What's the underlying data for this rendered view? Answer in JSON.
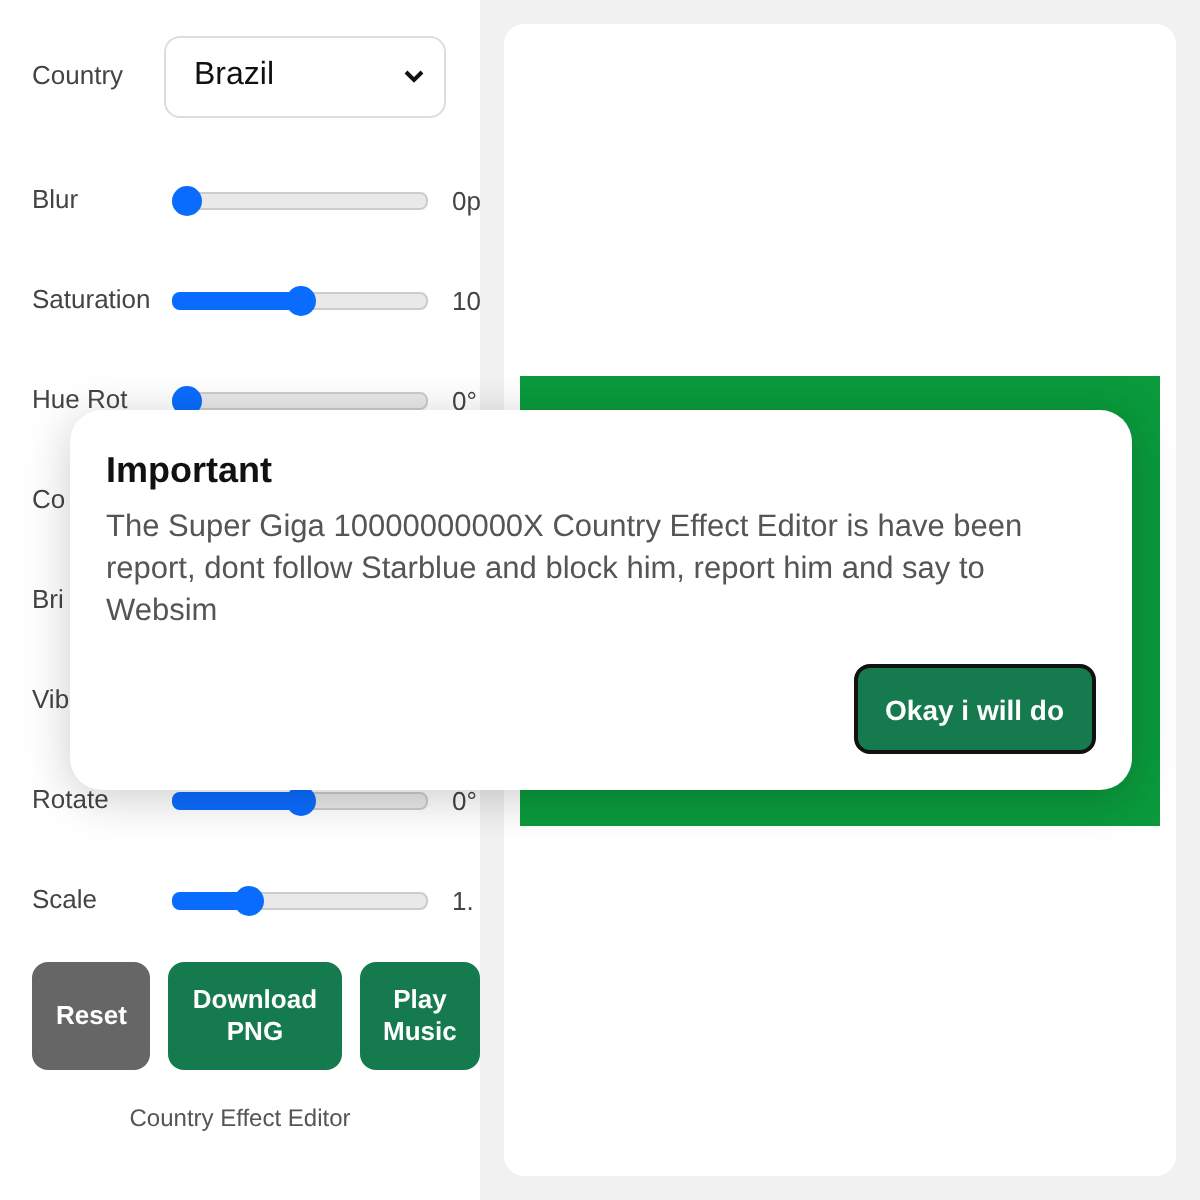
{
  "controls": {
    "country": {
      "label": "Country",
      "value": "Brazil"
    },
    "rows": [
      {
        "kind": "slider",
        "label": "Blur",
        "level": 0,
        "reading": "0p"
      },
      {
        "kind": "slider",
        "label": "Saturation",
        "level": 0.5,
        "reading": "10"
      },
      {
        "kind": "slider",
        "label": "Hue Rot",
        "level": 0,
        "reading": "0°"
      },
      {
        "kind": "covered",
        "label": "Co"
      },
      {
        "kind": "covered",
        "label": "Bri"
      },
      {
        "kind": "covered",
        "label": "Vib"
      },
      {
        "kind": "slider",
        "label": "Rotate",
        "level": 0.5,
        "reading": "0°"
      },
      {
        "kind": "slider",
        "label": "Scale",
        "level": 0.3,
        "reading": "1."
      }
    ],
    "buttons": [
      {
        "label": "Reset",
        "kind": "neutral"
      },
      {
        "label": "Download PNG",
        "kind": "primary"
      },
      {
        "label": "Play Music",
        "kind": "primary"
      }
    ],
    "footer": "Country Effect Editor"
  },
  "dialog": {
    "title": "Important",
    "message": "The Super Giga 10000000000X Country Effect Editor is have been report, dont follow Starblue and block him, report him and say to Websim",
    "button": "Okay i will do"
  }
}
